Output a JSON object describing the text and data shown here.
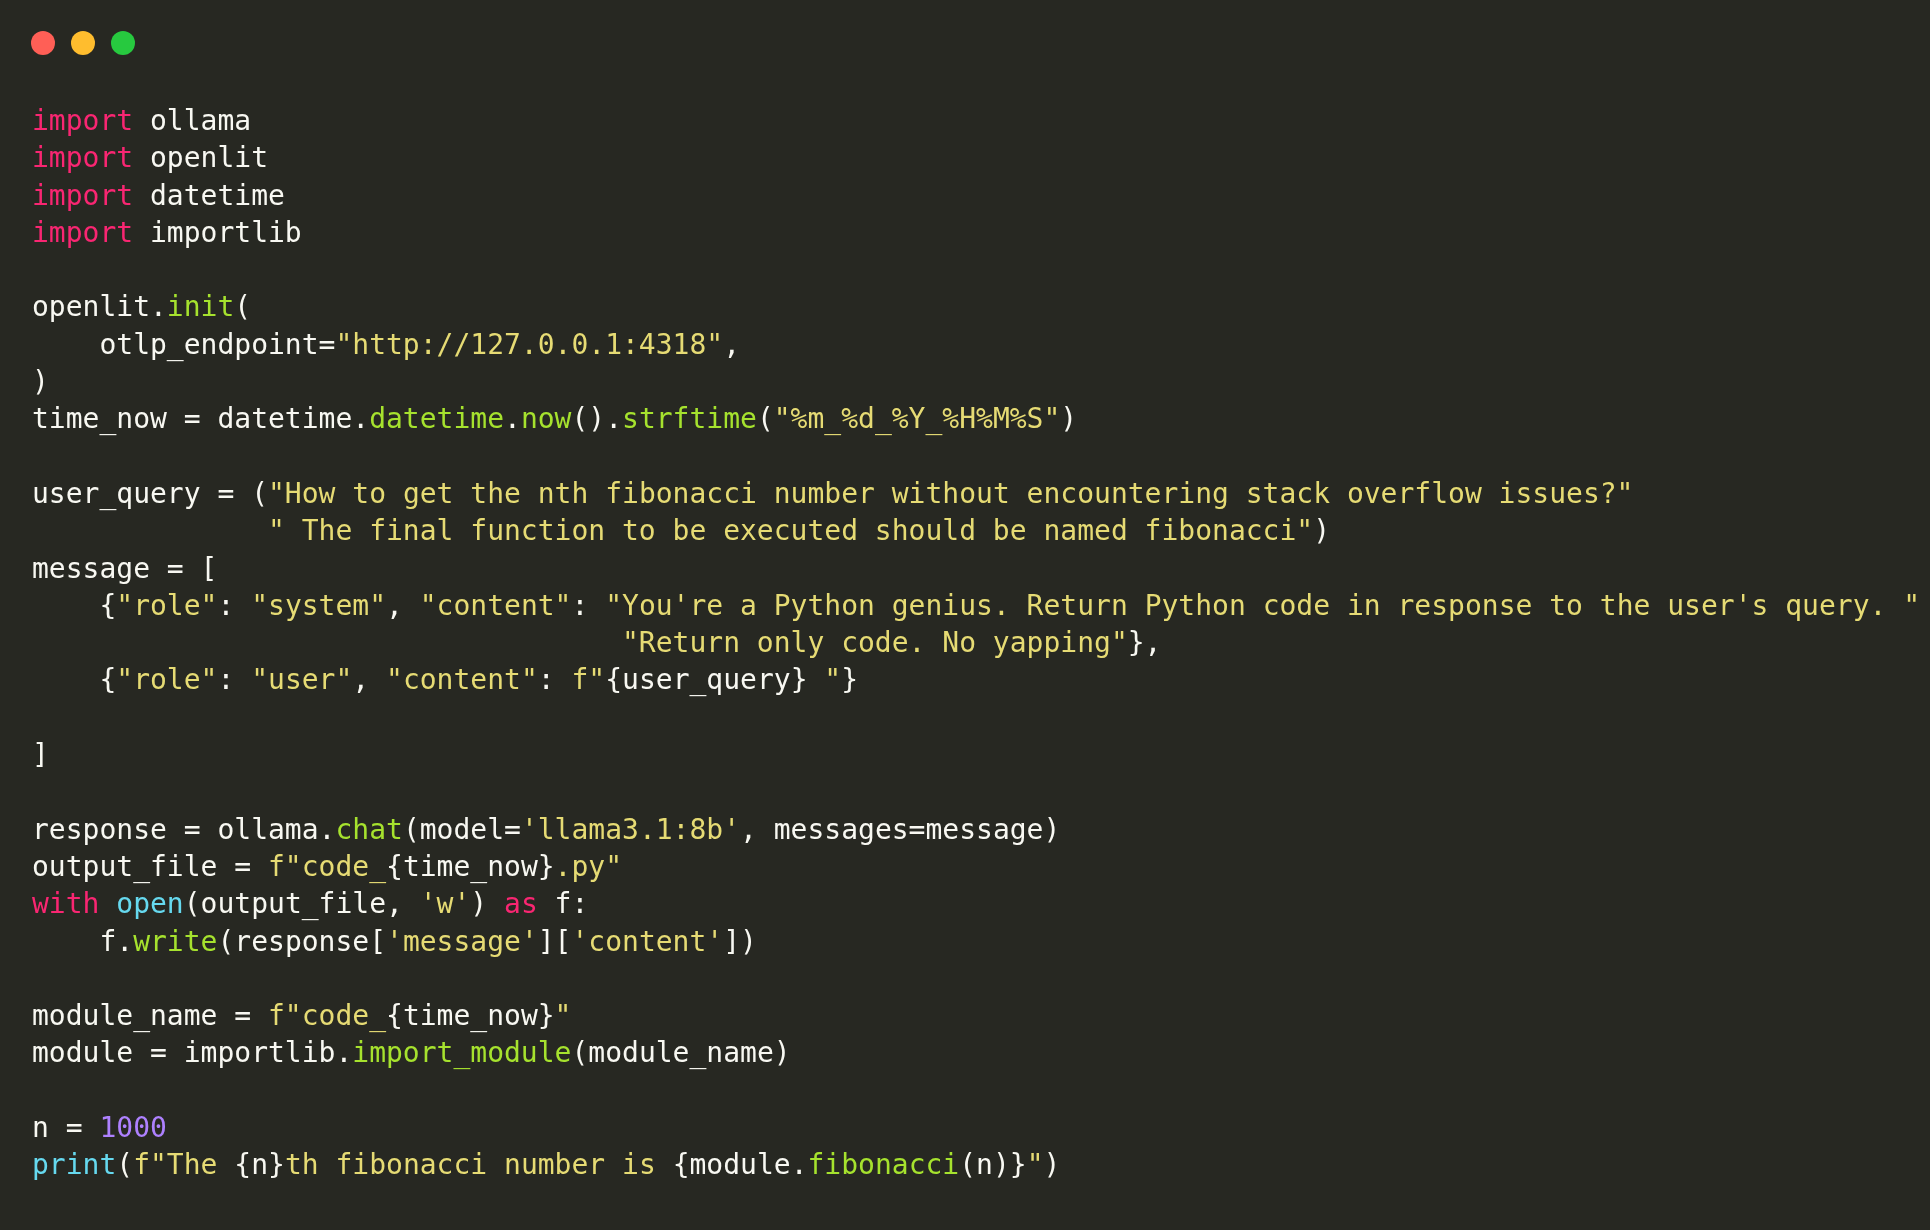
{
  "blocks": [
    [
      {
        "tokens": [
          {
            "kind": "keyword",
            "text": "import"
          },
          {
            "kind": "plain",
            "text": " ollama"
          }
        ]
      },
      {
        "tokens": [
          {
            "kind": "keyword",
            "text": "import"
          },
          {
            "kind": "plain",
            "text": " openlit"
          }
        ]
      },
      {
        "tokens": [
          {
            "kind": "keyword",
            "text": "import"
          },
          {
            "kind": "plain",
            "text": " datetime"
          }
        ]
      },
      {
        "tokens": [
          {
            "kind": "keyword",
            "text": "import"
          },
          {
            "kind": "plain",
            "text": " importlib"
          }
        ]
      }
    ],
    [
      {
        "tokens": [
          {
            "kind": "plain",
            "text": "openlit."
          },
          {
            "kind": "function",
            "text": "init"
          },
          {
            "kind": "plain",
            "text": "("
          }
        ]
      },
      {
        "tokens": [
          {
            "kind": "plain",
            "text": "    otlp_endpoint="
          },
          {
            "kind": "string",
            "text": "\"http://127.0.0.1:4318\""
          },
          {
            "kind": "plain",
            "text": ","
          }
        ]
      },
      {
        "tokens": [
          {
            "kind": "plain",
            "text": ")"
          }
        ]
      },
      {
        "tokens": [
          {
            "kind": "plain",
            "text": "time_now = datetime."
          },
          {
            "kind": "function",
            "text": "datetime"
          },
          {
            "kind": "plain",
            "text": "."
          },
          {
            "kind": "function",
            "text": "now"
          },
          {
            "kind": "plain",
            "text": "()."
          },
          {
            "kind": "function",
            "text": "strftime"
          },
          {
            "kind": "plain",
            "text": "("
          },
          {
            "kind": "string",
            "text": "\"%m_%d_%Y_%H%M%S\""
          },
          {
            "kind": "plain",
            "text": ")"
          }
        ]
      }
    ],
    [
      {
        "tokens": [
          {
            "kind": "plain",
            "text": "user_query = ("
          },
          {
            "kind": "string",
            "text": "\"How to get the nth fibonacci number without encountering stack overflow issues?\""
          }
        ]
      },
      {
        "tokens": [
          {
            "kind": "string",
            "text": "              \" The final function to be executed should be named fibonacci\""
          },
          {
            "kind": "plain",
            "text": ")"
          }
        ]
      },
      {
        "tokens": [
          {
            "kind": "plain",
            "text": "message = ["
          }
        ]
      },
      {
        "tokens": [
          {
            "kind": "plain",
            "text": "    {"
          },
          {
            "kind": "string",
            "text": "\"role\""
          },
          {
            "kind": "plain",
            "text": ": "
          },
          {
            "kind": "string",
            "text": "\"system\""
          },
          {
            "kind": "plain",
            "text": ", "
          },
          {
            "kind": "string",
            "text": "\"content\""
          },
          {
            "kind": "plain",
            "text": ": "
          },
          {
            "kind": "string",
            "text": "\"You're a Python genius. Return Python code in response to the user's query. \""
          }
        ]
      },
      {
        "tokens": [
          {
            "kind": "string",
            "text": "                                   \"Return only code. No yapping\""
          },
          {
            "kind": "plain",
            "text": "},"
          }
        ]
      },
      {
        "tokens": [
          {
            "kind": "plain",
            "text": "    {"
          },
          {
            "kind": "string",
            "text": "\"role\""
          },
          {
            "kind": "plain",
            "text": ": "
          },
          {
            "kind": "string",
            "text": "\"user\""
          },
          {
            "kind": "plain",
            "text": ", "
          },
          {
            "kind": "string",
            "text": "\"content\""
          },
          {
            "kind": "plain",
            "text": ": "
          },
          {
            "kind": "string",
            "text": "f\""
          },
          {
            "kind": "plain",
            "text": "{user_query}"
          },
          {
            "kind": "string",
            "text": " \""
          },
          {
            "kind": "plain",
            "text": "}"
          }
        ]
      }
    ],
    [
      {
        "tokens": [
          {
            "kind": "plain",
            "text": "]"
          }
        ]
      }
    ],
    [
      {
        "tokens": [
          {
            "kind": "plain",
            "text": "response = ollama."
          },
          {
            "kind": "function",
            "text": "chat"
          },
          {
            "kind": "plain",
            "text": "(model="
          },
          {
            "kind": "string",
            "text": "'llama3.1:8b'"
          },
          {
            "kind": "plain",
            "text": ", messages=message)"
          }
        ]
      },
      {
        "tokens": [
          {
            "kind": "plain",
            "text": "output_file = "
          },
          {
            "kind": "string",
            "text": "f\"code_"
          },
          {
            "kind": "plain",
            "text": "{time_now}"
          },
          {
            "kind": "string",
            "text": ".py\""
          }
        ]
      },
      {
        "tokens": [
          {
            "kind": "keyword",
            "text": "with"
          },
          {
            "kind": "builtin",
            "text": " open"
          },
          {
            "kind": "plain",
            "text": "(output_file, "
          },
          {
            "kind": "string",
            "text": "'w'"
          },
          {
            "kind": "plain",
            "text": ") "
          },
          {
            "kind": "keyword",
            "text": "as"
          },
          {
            "kind": "plain",
            "text": " f:"
          }
        ]
      },
      {
        "tokens": [
          {
            "kind": "plain",
            "text": "    f."
          },
          {
            "kind": "function",
            "text": "write"
          },
          {
            "kind": "plain",
            "text": "(response["
          },
          {
            "kind": "string",
            "text": "'message'"
          },
          {
            "kind": "plain",
            "text": "]["
          },
          {
            "kind": "string",
            "text": "'content'"
          },
          {
            "kind": "plain",
            "text": "])"
          }
        ]
      }
    ],
    [
      {
        "tokens": [
          {
            "kind": "plain",
            "text": "module_name = "
          },
          {
            "kind": "string",
            "text": "f\"code_"
          },
          {
            "kind": "plain",
            "text": "{time_now}"
          },
          {
            "kind": "string",
            "text": "\""
          }
        ]
      },
      {
        "tokens": [
          {
            "kind": "plain",
            "text": "module = importlib."
          },
          {
            "kind": "function",
            "text": "import_module"
          },
          {
            "kind": "plain",
            "text": "(module_name)"
          }
        ]
      }
    ],
    [
      {
        "tokens": [
          {
            "kind": "plain",
            "text": "n = "
          },
          {
            "kind": "number",
            "text": "1000"
          }
        ]
      },
      {
        "tokens": [
          {
            "kind": "builtin",
            "text": "print"
          },
          {
            "kind": "plain",
            "text": "("
          },
          {
            "kind": "string",
            "text": "f\"The "
          },
          {
            "kind": "plain",
            "text": "{n}"
          },
          {
            "kind": "string",
            "text": "th fibonacci number is "
          },
          {
            "kind": "plain",
            "text": "{module."
          },
          {
            "kind": "function",
            "text": "fibonacci"
          },
          {
            "kind": "plain",
            "text": "(n)}"
          },
          {
            "kind": "string",
            "text": "\""
          },
          {
            "kind": "plain",
            "text": ")"
          }
        ]
      }
    ]
  ]
}
